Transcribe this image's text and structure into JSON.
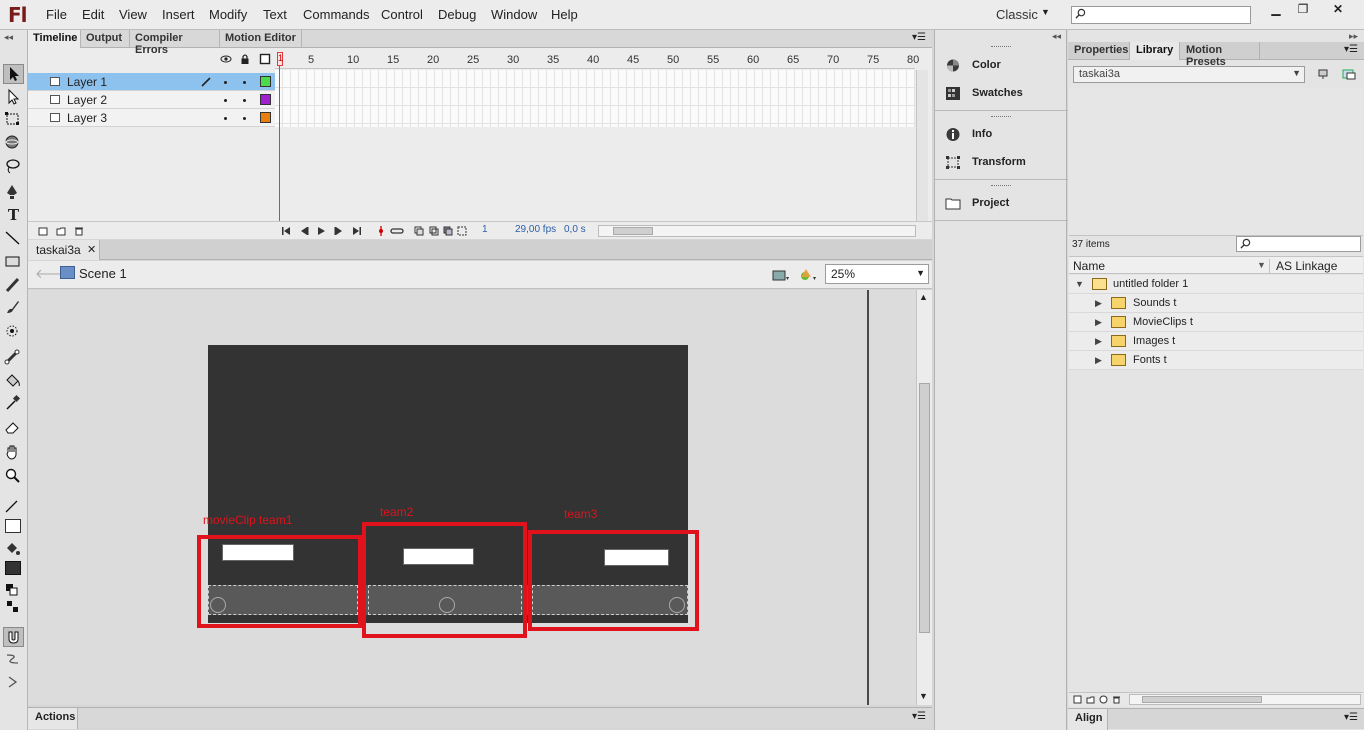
{
  "app": {
    "logo": "Fl",
    "workspace": "Classic"
  },
  "menu": [
    "File",
    "Edit",
    "View",
    "Insert",
    "Modify",
    "Text",
    "Commands",
    "Control",
    "Debug",
    "Window",
    "Help"
  ],
  "timeline": {
    "tabs": [
      "Timeline",
      "Output",
      "Compiler Errors",
      "Motion Editor"
    ],
    "layers": [
      {
        "name": "Layer 1",
        "color": "#4cd94c"
      },
      {
        "name": "Layer 2",
        "color": "#a020d0"
      },
      {
        "name": "Layer 3",
        "color": "#e87d10"
      }
    ],
    "ruler": [
      "1",
      "5",
      "10",
      "15",
      "20",
      "25",
      "30",
      "35",
      "40",
      "45",
      "50",
      "55",
      "60",
      "65",
      "70",
      "75",
      "80"
    ],
    "current_frame": "1",
    "fps": "29,00 fps",
    "time": "0,0 s"
  },
  "document": {
    "tab": "taskai3a",
    "scene": "Scene 1",
    "zoom": "25%"
  },
  "stage": {
    "annotations": [
      "movieClip team1",
      "team2",
      "team3"
    ]
  },
  "actions_label": "Actions",
  "dock": {
    "items": [
      "Color",
      "Swatches",
      "Info",
      "Transform",
      "Project"
    ]
  },
  "right_panel": {
    "tabs": [
      "Properties",
      "Library",
      "Motion Presets"
    ],
    "library_select": "taskai3a",
    "item_count": "37 items",
    "col_name": "Name",
    "col_linkage": "AS Linkage",
    "root_folder": "untitled folder 1",
    "folders": [
      "Sounds t",
      "MovieClips t",
      "Images t",
      "Fonts t"
    ]
  },
  "align_label": "Align",
  "colors": {
    "annotation_red": "#e0121b",
    "stage_bg": "#333333",
    "selected_layer": "#8dc2ee"
  }
}
